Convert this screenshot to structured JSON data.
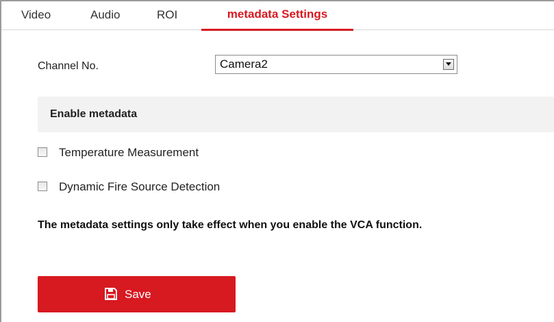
{
  "tabs": [
    {
      "label": "Video",
      "active": false
    },
    {
      "label": "Audio",
      "active": false
    },
    {
      "label": "ROI",
      "active": false
    },
    {
      "label": "metadata Settings",
      "active": true
    }
  ],
  "channel": {
    "label": "Channel No.",
    "selected": "Camera2",
    "dropdown_icon": "chevron-down-icon"
  },
  "section": {
    "title": "Enable metadata"
  },
  "options": [
    {
      "label": "Temperature Measurement",
      "checked": false
    },
    {
      "label": "Dynamic Fire Source Detection",
      "checked": false
    }
  ],
  "note": "The metadata settings only take effect when you enable the VCA function.",
  "save": {
    "label": "Save",
    "icon": "floppy-disk-icon"
  },
  "colors": {
    "accent": "#d71920",
    "section_bg": "#f2f2f2",
    "button_text": "#ffffff"
  }
}
